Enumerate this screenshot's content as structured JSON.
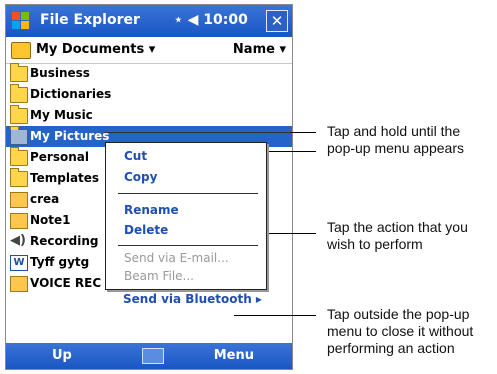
{
  "window": {
    "title": "File Explorer",
    "status": "⋆ ◀ 10:00",
    "close_label": "✕"
  },
  "header": {
    "folder": "My Documents ▾",
    "sort": "Name ▾"
  },
  "items": [
    {
      "label": "Business",
      "icon": "folder"
    },
    {
      "label": "Dictionaries",
      "icon": "folder"
    },
    {
      "label": "My Music",
      "icon": "folder"
    },
    {
      "label": "My Pictures",
      "icon": "folder-pictures",
      "selected": true
    },
    {
      "label": "Personal",
      "icon": "folder"
    },
    {
      "label": "Templates",
      "icon": "folder"
    },
    {
      "label": "crea",
      "icon": "note"
    },
    {
      "label": "Note1",
      "icon": "note"
    },
    {
      "label": "Recording",
      "icon": "sound"
    },
    {
      "label": "Tyff gytg",
      "icon": "word"
    },
    {
      "label": "VOICE REC",
      "icon": "note"
    }
  ],
  "popup_menu": {
    "items": [
      {
        "label": "Cut",
        "enabled": true
      },
      {
        "label": "Copy",
        "enabled": true
      },
      {
        "label": "Rename",
        "enabled": true
      },
      {
        "label": "Delete",
        "enabled": true
      },
      {
        "label": "Send via E-mail...",
        "enabled": false
      },
      {
        "label": "Beam File...",
        "enabled": false
      },
      {
        "label": "Send via Bluetooth ▸",
        "enabled": true
      }
    ]
  },
  "bottom_bar": {
    "left": "Up",
    "right": "Menu",
    "keyboard_icon": "keyboard-icon"
  },
  "annotations": [
    {
      "text_lines": [
        "Tap and hold until the",
        "pop-up menu appears"
      ]
    },
    {
      "text_lines": [
        "Tap the action that you",
        "wish to perform"
      ]
    },
    {
      "text_lines": [
        "Tap outside the pop-up",
        "menu to close it without",
        "performing an action"
      ]
    }
  ]
}
